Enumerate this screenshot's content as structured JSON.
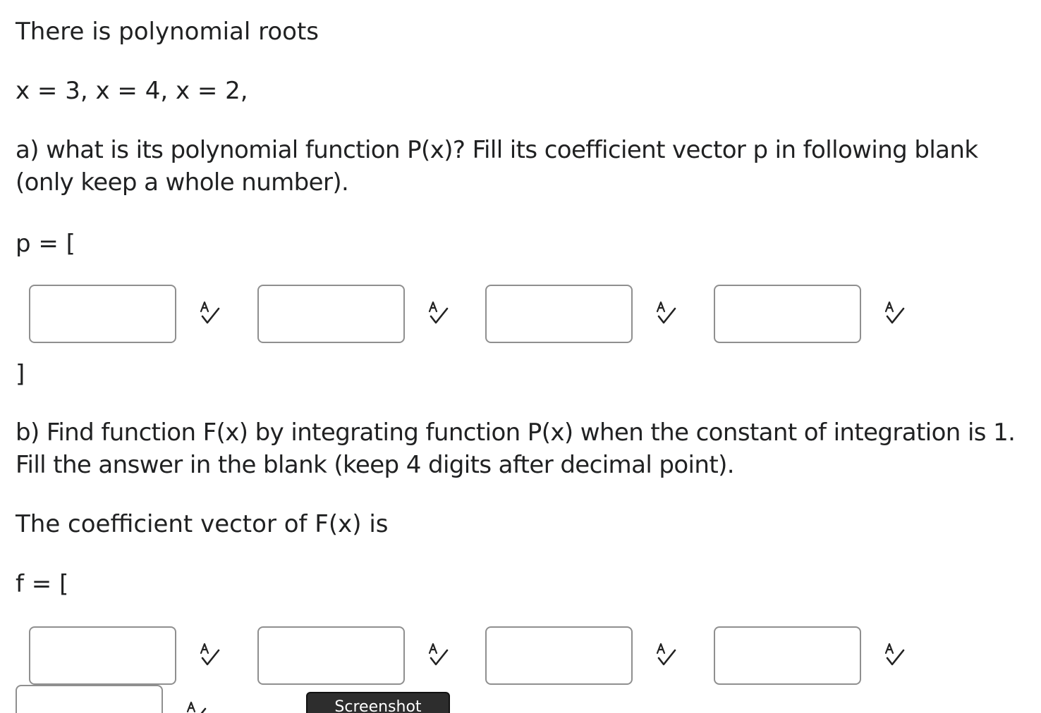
{
  "question": {
    "intro": "There is polynomial roots",
    "roots": "x = 3, x = 4, x = 2,",
    "part_a": "a) what is its polynomial function P(x)? Fill its coefficient vector p in following blank (only keep a whole number).",
    "p_open": "p = [",
    "p_close": "]",
    "part_b": "b) Find function F(x) by integrating function P(x) when the constant of integration is 1. Fill the answer in the blank (keep 4 digits after decimal point).",
    "coef_statement": "The coefficient vector of F(x) is",
    "f_open": "f = ["
  },
  "p_inputs": [
    {
      "value": ""
    },
    {
      "value": ""
    },
    {
      "value": ""
    },
    {
      "value": ""
    }
  ],
  "f_inputs": [
    {
      "value": ""
    },
    {
      "value": ""
    },
    {
      "value": ""
    },
    {
      "value": ""
    },
    {
      "value": ""
    }
  ],
  "check_icon_name": "answer-check-icon",
  "screenshot_button": {
    "label": "Screenshot"
  },
  "colors": {
    "text": "#202122",
    "input_border": "#8f8f8f",
    "icon": "#222222",
    "button_bg": "#2d2d2d"
  }
}
